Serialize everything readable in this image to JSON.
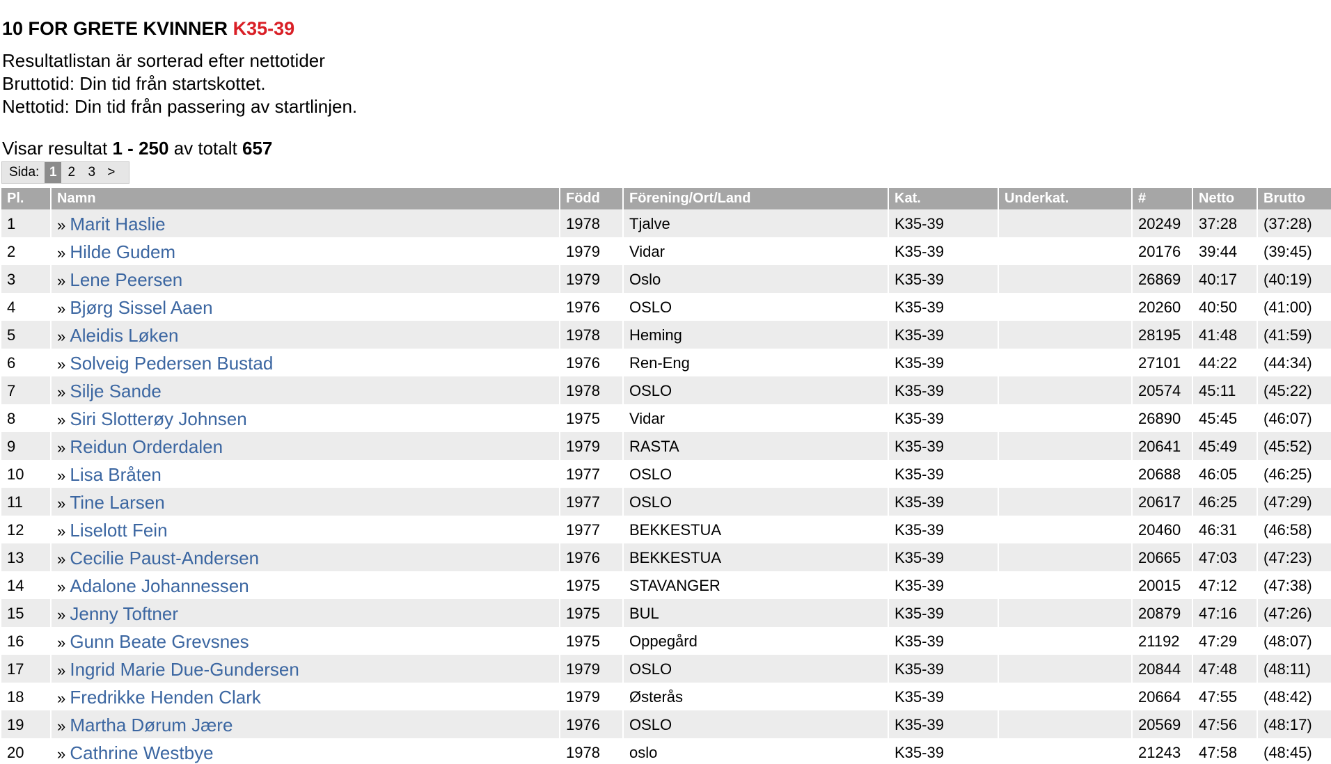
{
  "heading": {
    "prefix": "10 FOR GRETE KVINNER",
    "category": "K35-39"
  },
  "info": {
    "line1": "Resultatlistan är sorterad efter nettotider",
    "line2": "Bruttotid: Din tid från startskottet.",
    "line3": "Nettotid: Din tid från passering av startlinjen."
  },
  "summary": {
    "prefix": "Visar resultat",
    "range": "1 - 250",
    "middle": "av totalt",
    "total": "657"
  },
  "pager": {
    "label": "Sida:",
    "pages": [
      "1",
      "2",
      "3"
    ],
    "current": "1",
    "next": ">"
  },
  "table": {
    "headers": {
      "place": "Pl.",
      "name": "Namn",
      "born": "Född",
      "club": "Förening/Ort/Land",
      "cat": "Kat.",
      "subcat": "Underkat.",
      "bib": "#",
      "net": "Netto",
      "gross": "Brutto"
    },
    "rows": [
      {
        "place": "1",
        "name": "Marit Haslie",
        "born": "1978",
        "club": "Tjalve",
        "cat": "K35-39",
        "subcat": "",
        "bib": "20249",
        "net": "37:28",
        "gross": "(37:28)"
      },
      {
        "place": "2",
        "name": "Hilde Gudem",
        "born": "1979",
        "club": "Vidar",
        "cat": "K35-39",
        "subcat": "",
        "bib": "20176",
        "net": "39:44",
        "gross": "(39:45)"
      },
      {
        "place": "3",
        "name": "Lene Peersen",
        "born": "1979",
        "club": "Oslo",
        "cat": "K35-39",
        "subcat": "",
        "bib": "26869",
        "net": "40:17",
        "gross": "(40:19)"
      },
      {
        "place": "4",
        "name": "Bjørg Sissel Aaen",
        "born": "1976",
        "club": "OSLO",
        "cat": "K35-39",
        "subcat": "",
        "bib": "20260",
        "net": "40:50",
        "gross": "(41:00)"
      },
      {
        "place": "5",
        "name": "Aleidis Løken",
        "born": "1978",
        "club": "Heming",
        "cat": "K35-39",
        "subcat": "",
        "bib": "28195",
        "net": "41:48",
        "gross": "(41:59)"
      },
      {
        "place": "6",
        "name": "Solveig Pedersen Bustad",
        "born": "1976",
        "club": "Ren-Eng",
        "cat": "K35-39",
        "subcat": "",
        "bib": "27101",
        "net": "44:22",
        "gross": "(44:34)"
      },
      {
        "place": "7",
        "name": "Silje Sande",
        "born": "1978",
        "club": "OSLO",
        "cat": "K35-39",
        "subcat": "",
        "bib": "20574",
        "net": "45:11",
        "gross": "(45:22)"
      },
      {
        "place": "8",
        "name": "Siri Slotterøy Johnsen",
        "born": "1975",
        "club": "Vidar",
        "cat": "K35-39",
        "subcat": "",
        "bib": "26890",
        "net": "45:45",
        "gross": "(46:07)"
      },
      {
        "place": "9",
        "name": "Reidun Orderdalen",
        "born": "1979",
        "club": "RASTA",
        "cat": "K35-39",
        "subcat": "",
        "bib": "20641",
        "net": "45:49",
        "gross": "(45:52)"
      },
      {
        "place": "10",
        "name": "Lisa Bråten",
        "born": "1977",
        "club": "OSLO",
        "cat": "K35-39",
        "subcat": "",
        "bib": "20688",
        "net": "46:05",
        "gross": "(46:25)"
      },
      {
        "place": "11",
        "name": "Tine Larsen",
        "born": "1977",
        "club": "OSLO",
        "cat": "K35-39",
        "subcat": "",
        "bib": "20617",
        "net": "46:25",
        "gross": "(47:29)"
      },
      {
        "place": "12",
        "name": "Liselott Fein",
        "born": "1977",
        "club": "BEKKESTUA",
        "cat": "K35-39",
        "subcat": "",
        "bib": "20460",
        "net": "46:31",
        "gross": "(46:58)"
      },
      {
        "place": "13",
        "name": "Cecilie Paust-Andersen",
        "born": "1976",
        "club": "BEKKESTUA",
        "cat": "K35-39",
        "subcat": "",
        "bib": "20665",
        "net": "47:03",
        "gross": "(47:23)"
      },
      {
        "place": "14",
        "name": "Adalone Johannessen",
        "born": "1975",
        "club": "STAVANGER",
        "cat": "K35-39",
        "subcat": "",
        "bib": "20015",
        "net": "47:12",
        "gross": "(47:38)"
      },
      {
        "place": "15",
        "name": "Jenny Toftner",
        "born": "1975",
        "club": "BUL",
        "cat": "K35-39",
        "subcat": "",
        "bib": "20879",
        "net": "47:16",
        "gross": "(47:26)"
      },
      {
        "place": "16",
        "name": "Gunn Beate Grevsnes",
        "born": "1975",
        "club": "Oppegård",
        "cat": "K35-39",
        "subcat": "",
        "bib": "21192",
        "net": "47:29",
        "gross": "(48:07)"
      },
      {
        "place": "17",
        "name": "Ingrid Marie Due-Gundersen",
        "born": "1979",
        "club": "OSLO",
        "cat": "K35-39",
        "subcat": "",
        "bib": "20844",
        "net": "47:48",
        "gross": "(48:11)"
      },
      {
        "place": "18",
        "name": "Fredrikke Henden Clark",
        "born": "1979",
        "club": "Østerås",
        "cat": "K35-39",
        "subcat": "",
        "bib": "20664",
        "net": "47:55",
        "gross": "(48:42)"
      },
      {
        "place": "19",
        "name": "Martha Dørum Jære",
        "born": "1976",
        "club": "OSLO",
        "cat": "K35-39",
        "subcat": "",
        "bib": "20569",
        "net": "47:56",
        "gross": "(48:17)"
      },
      {
        "place": "20",
        "name": "Cathrine Westbye",
        "born": "1978",
        "club": "oslo",
        "cat": "K35-39",
        "subcat": "",
        "bib": "21243",
        "net": "47:58",
        "gross": "(48:45)"
      }
    ]
  },
  "colors": {
    "category_accent": "#d91f26",
    "link": "#3b66a1",
    "header_bg": "#a6a6a6",
    "row_alt_bg": "#ececec"
  }
}
